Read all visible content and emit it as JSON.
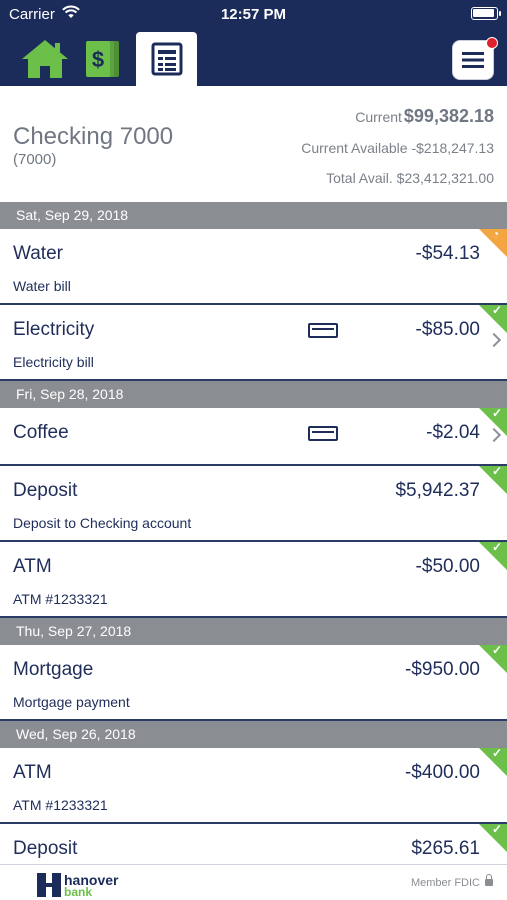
{
  "status_bar": {
    "carrier": "Carrier",
    "time": "12:57 PM"
  },
  "nav": {
    "tabs": [
      {
        "name": "home",
        "icon": "home-icon",
        "selected": false
      },
      {
        "name": "money",
        "icon": "money-icon",
        "selected": false
      },
      {
        "name": "ledger",
        "icon": "ledger-icon",
        "selected": true
      }
    ],
    "menu_icon": "hamburger-menu-icon",
    "has_notification": true
  },
  "account": {
    "name": "Checking 7000",
    "number": "(7000)",
    "current_label": "Current",
    "current_value": "$99,382.18",
    "current_available": "Current Available -$218,247.13",
    "total_available": "Total Avail. $23,412,321.00"
  },
  "groups": [
    {
      "date": "Sat, Sep 29, 2018",
      "transactions": [
        {
          "title": "Water",
          "memo": "Water bill",
          "amount": "-$54.13",
          "status": "pending"
        },
        {
          "title": "Electricity",
          "memo": "Electricity bill",
          "amount": "-$85.00",
          "status": "cleared",
          "card": true,
          "chevron": true
        }
      ]
    },
    {
      "date": "Fri, Sep 28, 2018",
      "transactions": [
        {
          "title": "Coffee",
          "memo": "",
          "amount": "-$2.04",
          "status": "cleared",
          "card": true,
          "chevron": true
        },
        {
          "title": "Deposit",
          "memo": "Deposit to Checking account",
          "amount": "$5,942.37",
          "status": "cleared"
        },
        {
          "title": "ATM",
          "memo": "ATM #1233321",
          "amount": "-$50.00",
          "status": "cleared"
        }
      ]
    },
    {
      "date": "Thu, Sep 27, 2018",
      "transactions": [
        {
          "title": "Mortgage",
          "memo": "Mortgage payment",
          "amount": "-$950.00",
          "status": "cleared"
        }
      ]
    },
    {
      "date": "Wed, Sep 26, 2018",
      "transactions": [
        {
          "title": "ATM",
          "memo": "ATM #1233321",
          "amount": "-$400.00",
          "status": "cleared"
        },
        {
          "title": "Deposit",
          "memo": "",
          "amount": "$265.61",
          "status": "cleared"
        }
      ]
    }
  ],
  "footer": {
    "logo_word1": "hanover",
    "logo_word2": "bank",
    "fdic": "Member FDIC"
  },
  "colors": {
    "navy": "#1b2c5b",
    "cleared": "#6cc04a",
    "pending": "#f2a541",
    "date_header": "#8a8d92"
  }
}
